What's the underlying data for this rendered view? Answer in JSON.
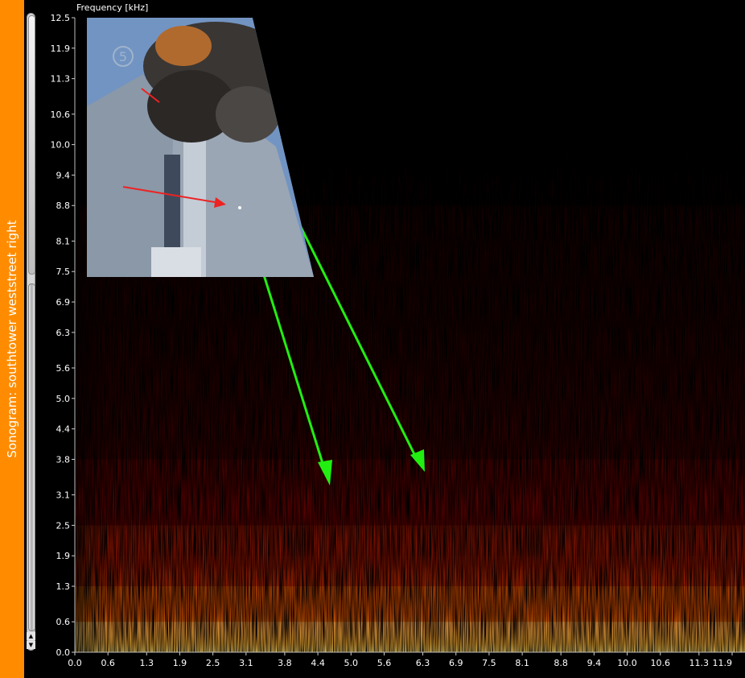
{
  "sidebar": {
    "title": "Sonogram: southtower weststreet right"
  },
  "scrollbar": {
    "up_glyph": "▲",
    "down_glyph": "▼"
  },
  "colors": {
    "sidebar": "#ff8c00",
    "background": "#000000",
    "arrow_green": "#22ee11",
    "arrow_red": "#ee2222"
  },
  "chart_data": {
    "type": "heatmap",
    "title": "Frequency [kHz]",
    "xlabel": "",
    "ylabel": "Frequency [kHz]",
    "xlim": [
      0.0,
      11.9
    ],
    "ylim": [
      0.0,
      12.5
    ],
    "x_ticks": [
      "0.0",
      "0.6",
      "1.3",
      "1.9",
      "2.5",
      "3.1",
      "3.8",
      "4.4",
      "5.0",
      "5.6",
      "6.3",
      "6.9",
      "7.5",
      "8.1",
      "8.8",
      "9.4",
      "10.0",
      "10.6",
      "11.3",
      "11.9"
    ],
    "y_ticks": [
      "0.0",
      "0.6",
      "1.3",
      "1.9",
      "2.5",
      "3.1",
      "3.8",
      "4.4",
      "5.0",
      "5.6",
      "6.3",
      "6.9",
      "7.5",
      "8.1",
      "8.8",
      "9.4",
      "10.0",
      "10.6",
      "11.3",
      "11.9",
      "12.5"
    ],
    "colormap": [
      "#000000",
      "#3a0000",
      "#8a0a00",
      "#d23a00",
      "#ff8a00",
      "#ffe27a"
    ],
    "energy_profile_by_frequency": [
      {
        "khz": 0.0,
        "level": 1.0
      },
      {
        "khz": 0.6,
        "level": 0.78
      },
      {
        "khz": 1.3,
        "level": 0.62
      },
      {
        "khz": 1.9,
        "level": 0.5
      },
      {
        "khz": 2.5,
        "level": 0.42
      },
      {
        "khz": 3.1,
        "level": 0.35
      },
      {
        "khz": 3.8,
        "level": 0.29
      },
      {
        "khz": 4.4,
        "level": 0.25
      },
      {
        "khz": 5.0,
        "level": 0.21
      },
      {
        "khz": 5.6,
        "level": 0.17
      },
      {
        "khz": 6.3,
        "level": 0.14
      },
      {
        "khz": 7.5,
        "level": 0.1
      },
      {
        "khz": 8.8,
        "level": 0.07
      },
      {
        "khz": 10.0,
        "level": 0.04
      },
      {
        "khz": 11.3,
        "level": 0.02
      },
      {
        "khz": 12.5,
        "level": 0.0
      }
    ],
    "grid": false
  },
  "inset": {
    "channel_logo": "5"
  }
}
